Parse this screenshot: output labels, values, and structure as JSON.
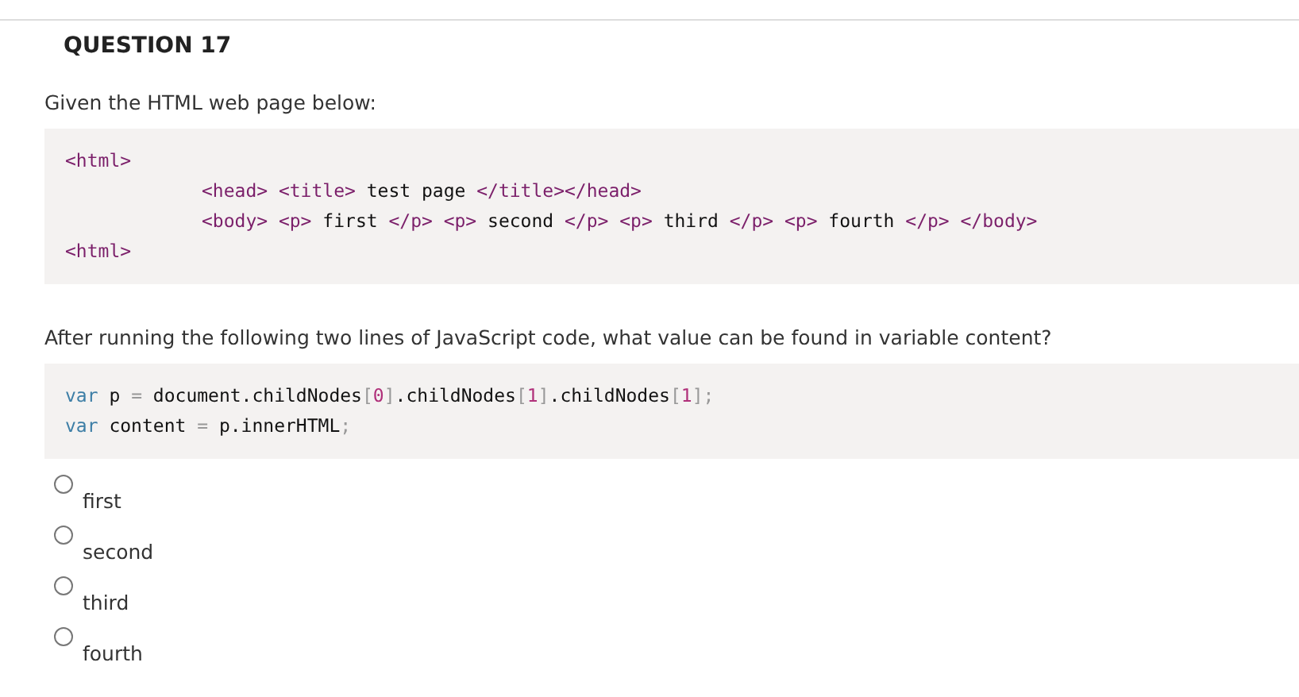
{
  "question": {
    "title": "QUESTION 17"
  },
  "intro": "Given the HTML web page below:",
  "html_code": [
    {
      "indented": false,
      "tokens": [
        {
          "kind": "tag",
          "text": "<html>"
        }
      ]
    },
    {
      "indented": true,
      "tokens": [
        {
          "kind": "tag",
          "text": "<head> <title>"
        },
        {
          "kind": "plain",
          "text": " test page "
        },
        {
          "kind": "tag",
          "text": "</title></head>"
        }
      ]
    },
    {
      "indented": true,
      "tokens": [
        {
          "kind": "tag",
          "text": "<body> <p>"
        },
        {
          "kind": "plain",
          "text": " first "
        },
        {
          "kind": "tag",
          "text": "</p> <p>"
        },
        {
          "kind": "plain",
          "text": " second "
        },
        {
          "kind": "tag",
          "text": "</p> <p>"
        },
        {
          "kind": "plain",
          "text": " third "
        },
        {
          "kind": "tag",
          "text": "</p> <p>"
        },
        {
          "kind": "plain",
          "text": " fourth "
        },
        {
          "kind": "tag",
          "text": "</p> </body>"
        }
      ]
    },
    {
      "indented": false,
      "tokens": [
        {
          "kind": "tag",
          "text": "<html>"
        }
      ]
    }
  ],
  "prompt": "After running the following two lines of JavaScript code, what value can be found in variable content?",
  "js_code": [
    {
      "indented": false,
      "tokens": [
        {
          "kind": "keyword",
          "text": "var"
        },
        {
          "kind": "plain",
          "text": " p "
        },
        {
          "kind": "punct",
          "text": "="
        },
        {
          "kind": "plain",
          "text": " document.childNodes"
        },
        {
          "kind": "punct",
          "text": "["
        },
        {
          "kind": "number",
          "text": "0"
        },
        {
          "kind": "punct",
          "text": "]"
        },
        {
          "kind": "plain",
          "text": ".childNodes"
        },
        {
          "kind": "punct",
          "text": "["
        },
        {
          "kind": "number",
          "text": "1"
        },
        {
          "kind": "punct",
          "text": "]"
        },
        {
          "kind": "plain",
          "text": ".childNodes"
        },
        {
          "kind": "punct",
          "text": "["
        },
        {
          "kind": "number",
          "text": "1"
        },
        {
          "kind": "punct",
          "text": "];"
        }
      ]
    },
    {
      "indented": false,
      "tokens": [
        {
          "kind": "keyword",
          "text": "var"
        },
        {
          "kind": "plain",
          "text": " content "
        },
        {
          "kind": "punct",
          "text": "="
        },
        {
          "kind": "plain",
          "text": " p.innerHTML"
        },
        {
          "kind": "punct",
          "text": ";"
        }
      ]
    }
  ],
  "options": [
    {
      "label": "first",
      "selected": false
    },
    {
      "label": "second",
      "selected": false
    },
    {
      "label": "third",
      "selected": false
    },
    {
      "label": "fourth",
      "selected": false
    }
  ]
}
